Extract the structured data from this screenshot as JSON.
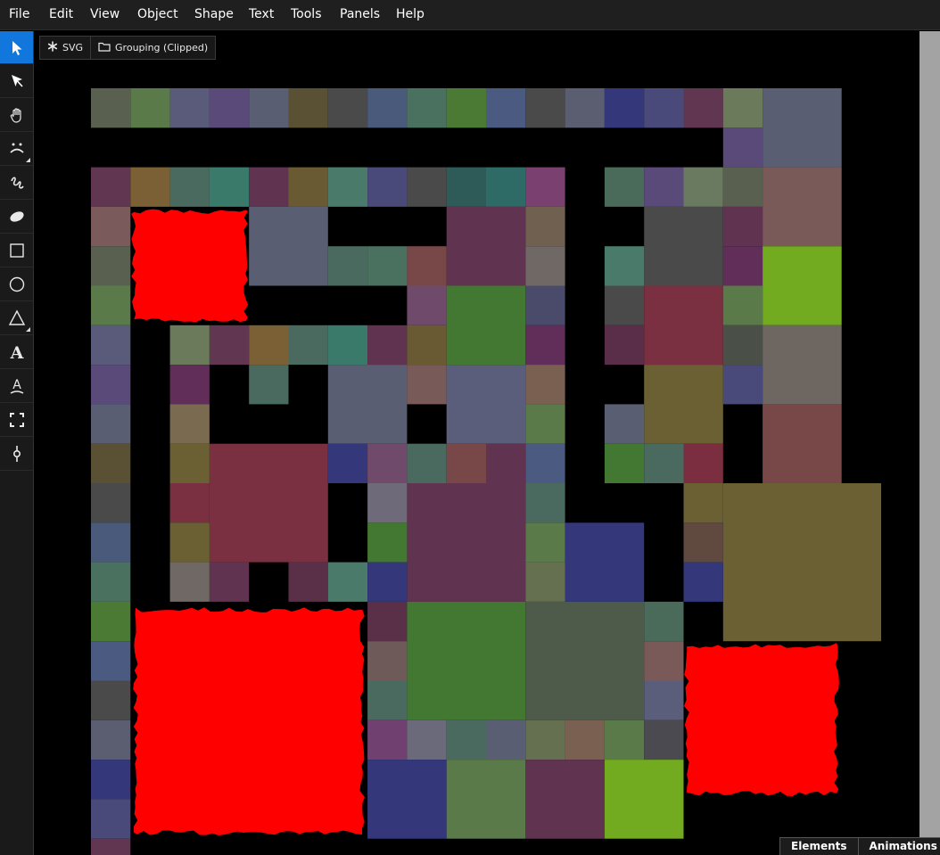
{
  "menu": [
    "File",
    "Edit",
    "View",
    "Object",
    "Shape",
    "Text",
    "Tools",
    "Panels",
    "Help"
  ],
  "tools": [
    {
      "name": "select-arrow-icon",
      "active": true
    },
    {
      "name": "node-select-icon",
      "active": false
    },
    {
      "name": "hand-pan-icon",
      "active": false
    },
    {
      "name": "face-tool-icon",
      "active": false,
      "corner": true
    },
    {
      "name": "freehand-pen-icon",
      "active": false
    },
    {
      "name": "ellipse-filled-icon",
      "active": false
    },
    {
      "name": "rectangle-icon",
      "active": false
    },
    {
      "name": "circle-icon",
      "active": false
    },
    {
      "name": "triangle-icon",
      "active": false,
      "corner": true
    },
    {
      "name": "text-tool-icon",
      "active": false
    },
    {
      "name": "text-on-path-icon",
      "active": false
    },
    {
      "name": "crop-frame-icon",
      "active": false
    },
    {
      "name": "gradient-handle-icon",
      "active": false
    }
  ],
  "breadcrumb": [
    {
      "label": "SVG",
      "icon": "asterisk-icon"
    },
    {
      "label": "Grouping (Clipped)",
      "icon": "folder-icon"
    }
  ],
  "panel_tabs": [
    "Elements",
    "Animations"
  ],
  "colors": {
    "accent": "#1177dd",
    "canvas": "#000000",
    "blob": "#ff0000"
  }
}
